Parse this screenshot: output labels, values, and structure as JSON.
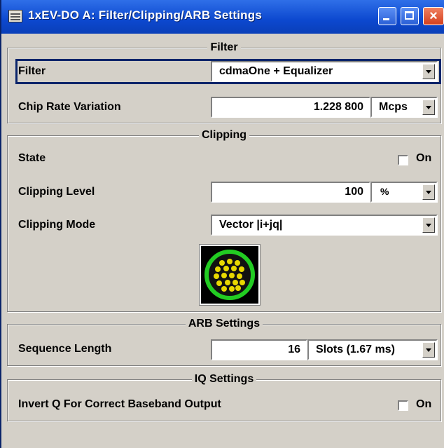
{
  "window": {
    "title": "1xEV-DO A: Filter/Clipping/ARB Settings"
  },
  "filter_section": {
    "legend": "Filter",
    "filter": {
      "label": "Filter",
      "value": "cdmaOne + Equalizer"
    },
    "chip_rate": {
      "label": "Chip Rate Variation",
      "value": "1.228 800",
      "unit": "Mcps"
    }
  },
  "clipping_section": {
    "legend": "Clipping",
    "state": {
      "label": "State",
      "checkbox_label": "On",
      "checked": false
    },
    "level": {
      "label": "Clipping Level",
      "value": "100",
      "unit": "%"
    },
    "mode": {
      "label": "Clipping Mode",
      "value": "Vector |i+jq|"
    },
    "icon": "constellation-icon"
  },
  "arb_section": {
    "legend": "ARB Settings",
    "sequence_length": {
      "label": "Sequence Length",
      "value": "16",
      "unit": "Slots (1.67 ms)"
    }
  },
  "iq_section": {
    "legend": "IQ Settings",
    "invert_q": {
      "label": "Invert Q For Correct Baseband Output",
      "checkbox_label": "On",
      "checked": false
    }
  },
  "colors": {
    "title_bar": "#0c48cf",
    "dialog_bg": "#d4d0c8",
    "focus_border": "#0a246a",
    "icon_ring": "#22cc22",
    "icon_dots": "#e8d800"
  }
}
